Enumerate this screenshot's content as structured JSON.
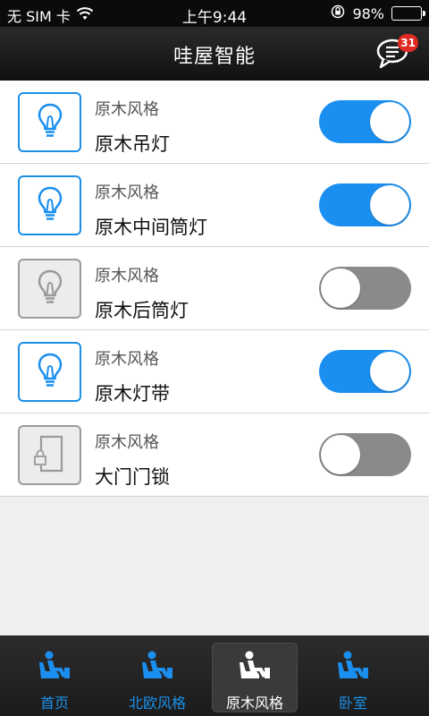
{
  "status_bar": {
    "carrier": "无 SIM 卡",
    "time": "上午9:44",
    "battery": "98%",
    "battery_level": 0.98
  },
  "header": {
    "title": "哇屋智能",
    "message_badge": "31"
  },
  "devices": [
    {
      "style": "原木风格",
      "name": "原木吊灯",
      "icon": "lightbulb-icon",
      "state": "on"
    },
    {
      "style": "原木风格",
      "name": "原木中间筒灯",
      "icon": "lightbulb-icon",
      "state": "on"
    },
    {
      "style": "原木风格",
      "name": "原木后筒灯",
      "icon": "lightbulb-icon",
      "state": "off"
    },
    {
      "style": "原木风格",
      "name": "原木灯带",
      "icon": "lightbulb-icon",
      "state": "on"
    },
    {
      "style": "原木风格",
      "name": "大门门锁",
      "icon": "door-lock-icon",
      "state": "off"
    }
  ],
  "tabs": [
    {
      "label": "首页",
      "icon": "seat-icon",
      "active": false
    },
    {
      "label": "北欧风格",
      "icon": "seat-icon",
      "active": false
    },
    {
      "label": "原木风格",
      "icon": "seat-icon",
      "active": true
    },
    {
      "label": "卧室",
      "icon": "seat-icon",
      "active": false
    }
  ],
  "colors": {
    "accent": "#1b8ff0",
    "toggle_off": "#8a8a8a",
    "badge": "#e02b22"
  }
}
